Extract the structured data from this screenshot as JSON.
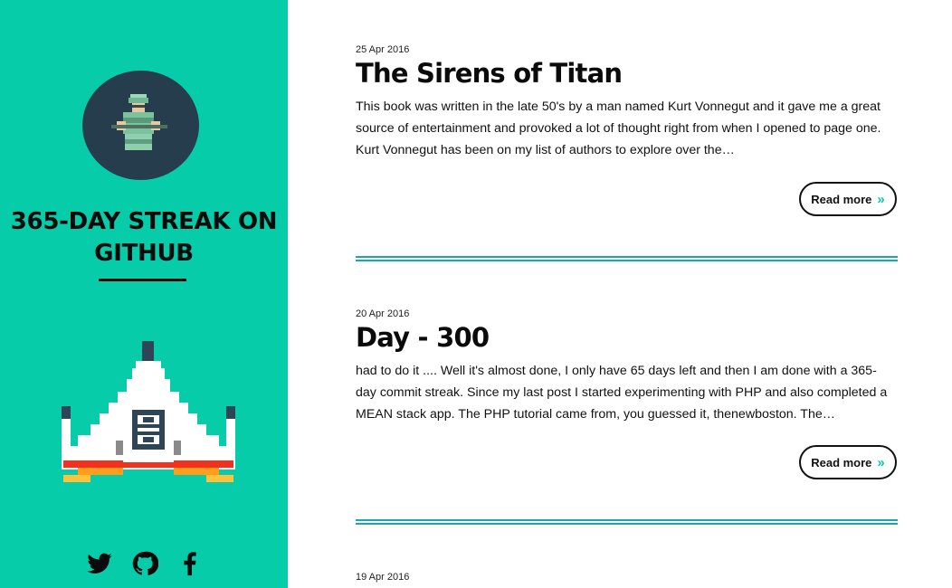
{
  "sidebar": {
    "site_title": "365-DAY STREAK ON GITHUB",
    "social": [
      "twitter-icon",
      "github-icon",
      "facebook-icon"
    ]
  },
  "posts": [
    {
      "date": "25 Apr 2016",
      "title": "The Sirens of Titan",
      "excerpt": "This book was written in the late 50's by a man named Kurt Vonnegut and it gave me a great source of entertainment and provoked a lot of thought right from when I opened to page one. Kurt Vonnegut has been on my list of authors to explore over the…",
      "read_more": "Read more"
    },
    {
      "date": "20 Apr 2016",
      "title": "Day - 300",
      "excerpt": "had to do it .... Well it's almost done, I only have 65 days left and then I am done with a 365-day commit streak. Since my last post I started experimenting with PHP and also completed a MEAN stack app. The PHP tutorial came from, you guessed it, thenewboston. The…",
      "read_more": "Read more"
    },
    {
      "date": "19 Apr 2016"
    }
  ],
  "colors": {
    "accent": "#07cca9",
    "avatar_bg": "#263d4d",
    "divider": "#1aa7b0"
  }
}
